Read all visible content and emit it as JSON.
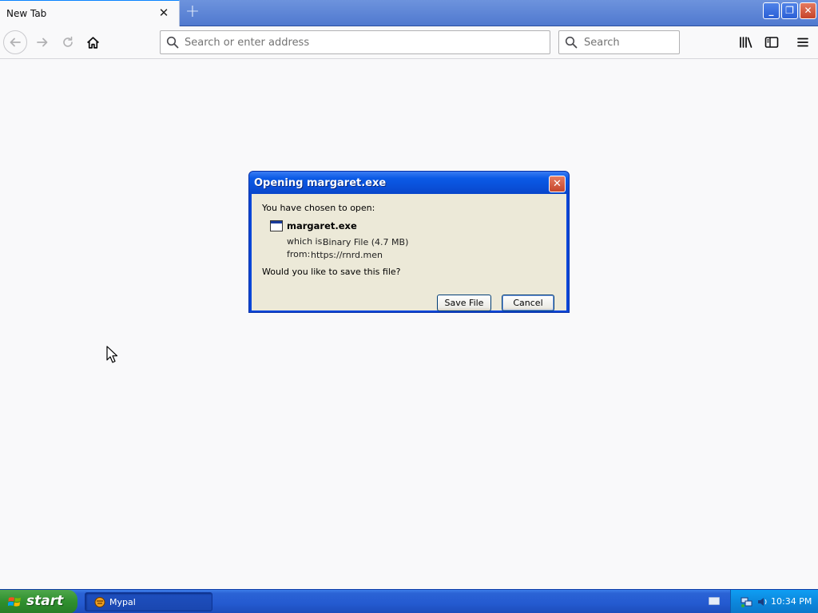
{
  "browser": {
    "tab": {
      "title": "New Tab",
      "close_glyph": "✕"
    },
    "new_tab_glyph": "+",
    "url_placeholder": "Search or enter address",
    "search_placeholder": "Search",
    "window_controls": {
      "minimize": "_",
      "maximize": "❐",
      "close": "✕"
    },
    "icons": [
      "back-icon",
      "forward-icon",
      "reload-icon",
      "home-icon",
      "library-icon",
      "sidebar-icon",
      "menu-icon"
    ]
  },
  "dialog": {
    "title": "Opening margaret.exe",
    "close_glyph": "✕",
    "prompt": "You have chosen to open:",
    "file_name": "margaret.exe",
    "which_label": "which is:",
    "which_value": "Binary File (4.7 MB)",
    "from_label": "from:",
    "from_value": "https://rnrd.men",
    "question": "Would you like to save this file?",
    "save_label": "Save File",
    "cancel_label": "Cancel"
  },
  "taskbar": {
    "start_label": "start",
    "task_label": "Mypal",
    "clock": "10:34 PM"
  },
  "colors": {
    "xp_blue": "#0a46d8",
    "dialog_face": "#ece9d8",
    "start_green": "#2f8f2e",
    "tray_blue": "#0c88dd"
  }
}
